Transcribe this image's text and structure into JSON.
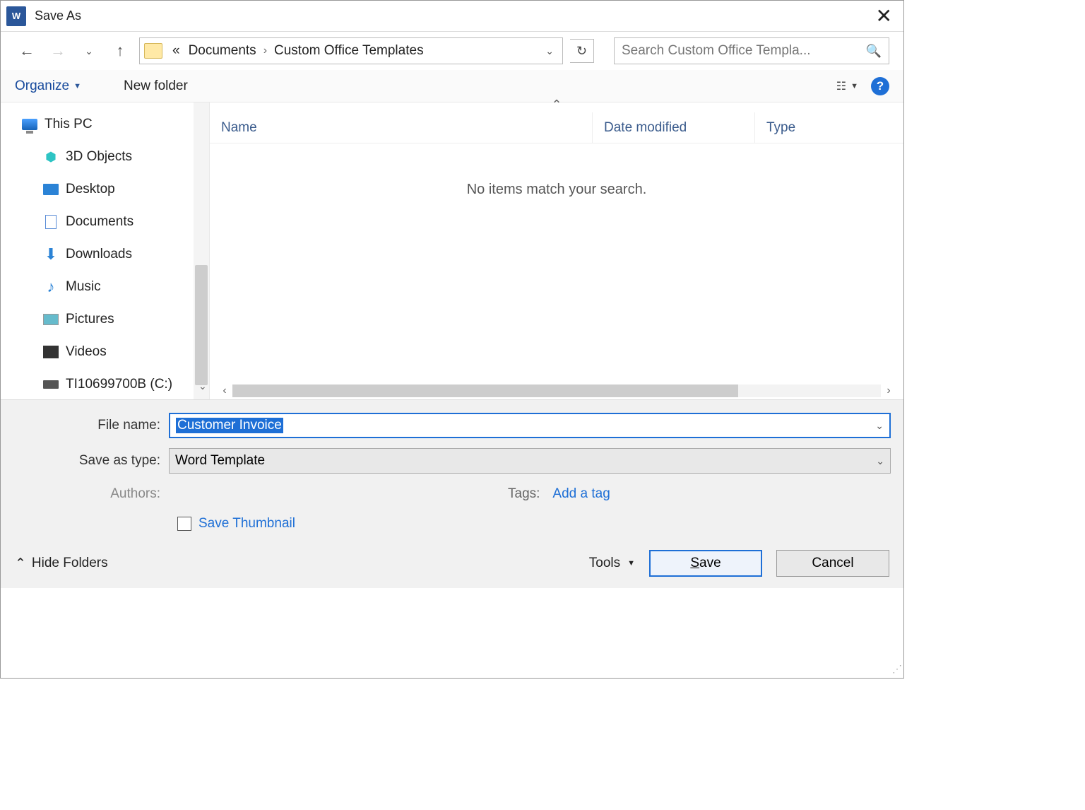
{
  "titlebar": {
    "title": "Save As"
  },
  "nav": {
    "breadcrumb_prefix": "«",
    "crumbs": [
      "Documents",
      "Custom Office Templates"
    ],
    "search_placeholder": "Search Custom Office Templa..."
  },
  "toolbar": {
    "organize": "Organize",
    "new_folder": "New folder"
  },
  "tree": {
    "root": "This PC",
    "items": [
      "3D Objects",
      "Desktop",
      "Documents",
      "Downloads",
      "Music",
      "Pictures",
      "Videos",
      "TI10699700B (C:)"
    ]
  },
  "columns": {
    "name": "Name",
    "date": "Date modified",
    "type": "Type"
  },
  "empty_message": "No items match your search.",
  "form": {
    "filename_label": "File name:",
    "filename_value": "Customer Invoice",
    "type_label": "Save as type:",
    "type_value": "Word Template",
    "authors_label": "Authors:",
    "tags_label": "Tags:",
    "add_tag": "Add a tag",
    "save_thumbnail": "Save Thumbnail"
  },
  "footer": {
    "hide_folders": "Hide Folders",
    "tools": "Tools",
    "save": "Save",
    "cancel": "Cancel"
  }
}
